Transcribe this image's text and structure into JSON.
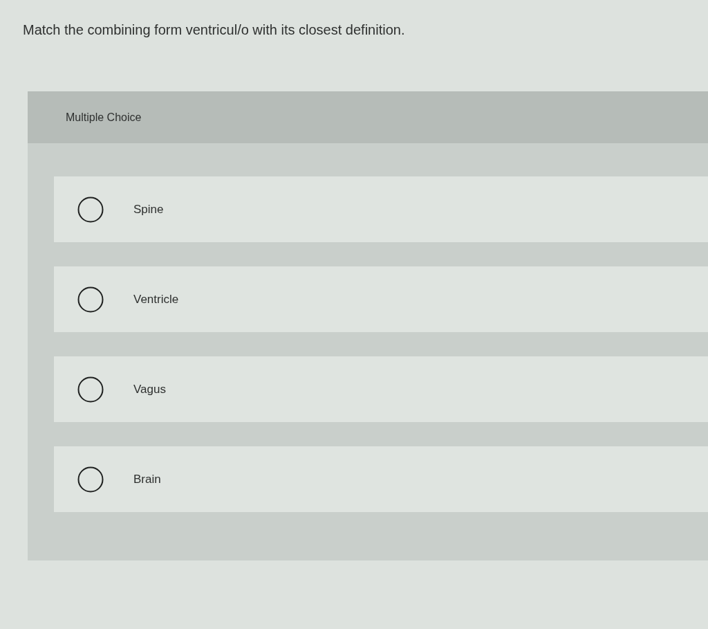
{
  "question": "Match the combining form ventricul/o with its closest definition.",
  "panel": {
    "title": "Multiple Choice"
  },
  "options": [
    {
      "label": "Spine",
      "selected": false
    },
    {
      "label": "Ventricle",
      "selected": false
    },
    {
      "label": "Vagus",
      "selected": false
    },
    {
      "label": "Brain",
      "selected": false
    }
  ]
}
